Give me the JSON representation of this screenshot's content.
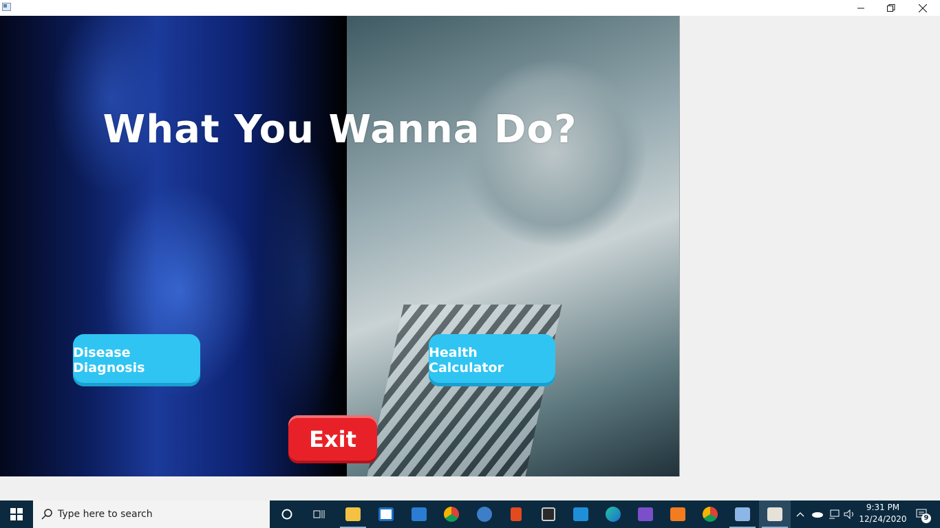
{
  "window": {
    "controls": {
      "minimize_icon": "minimize-icon",
      "restore_icon": "restore-icon",
      "close_icon": "close-icon"
    }
  },
  "main": {
    "title": "What You Wanna Do?",
    "buttons": {
      "disease_diagnosis": "Disease Diagnosis",
      "health_calculator": "Health Calculator",
      "exit": "Exit"
    },
    "colors": {
      "primary_button": "#30c4f2",
      "exit_button": "#e82128"
    }
  },
  "taskbar": {
    "search_placeholder": "Type here to search",
    "apps": [
      "cortana-icon",
      "task-view-icon",
      "file-explorer-icon",
      "store-icon",
      "mail-icon",
      "chrome-icon",
      "qbittorrent-icon",
      "office-icon",
      "app-icon",
      "outlook-icon",
      "edge-icon",
      "visual-studio-icon",
      "xampp-icon",
      "chrome-icon",
      "virtualbox-icon",
      "java-icon"
    ],
    "clock": {
      "time": "9:31 PM",
      "date": "12/24/2020"
    },
    "notification_count": "9"
  }
}
